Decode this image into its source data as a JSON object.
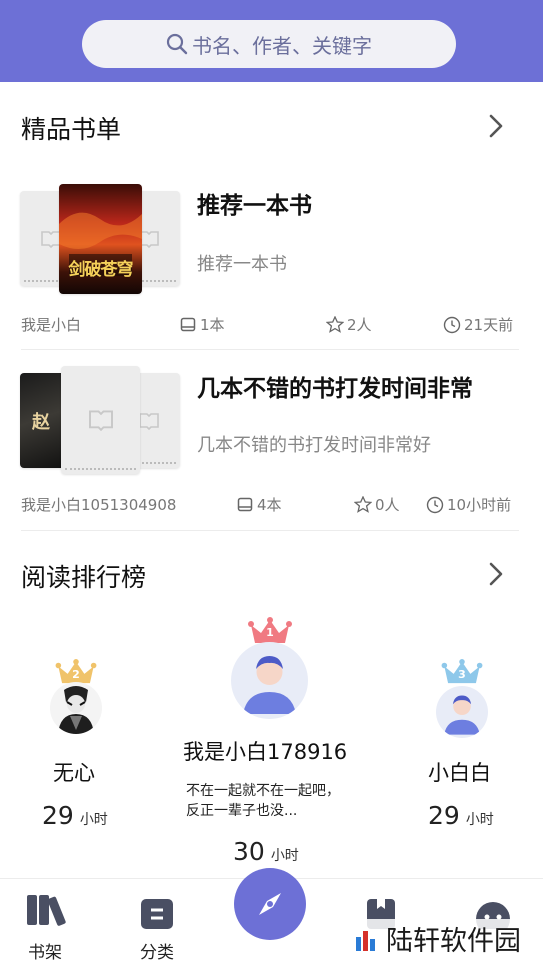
{
  "search": {
    "placeholder": "书名、作者、关键字"
  },
  "booklist_section": {
    "title": "精品书单",
    "cards": [
      {
        "title": "推荐一本书",
        "desc": "推荐一本书",
        "author": "我是小白",
        "count": "1本",
        "likes": "2人",
        "time": "21天前",
        "cover_text": "剑破苍穹"
      },
      {
        "title": "几本不错的书打发时间非常",
        "desc": "几本不错的书打发时间非常好",
        "author": "我是小白1051304908",
        "count": "4本",
        "likes": "0人",
        "time": "10小时前",
        "cover_text": "赵"
      }
    ]
  },
  "ranking_section": {
    "title": "阅读排行榜",
    "first": {
      "rank": "1",
      "name": "我是小白178916",
      "motto": "不在一起就不在一起吧，反正一辈子也没...",
      "hours": "30",
      "unit": "小时",
      "crown_color": "#f07a82"
    },
    "second": {
      "rank": "2",
      "name": "无心",
      "hours": "29",
      "unit": "小时",
      "crown_color": "#f0c36a"
    },
    "third": {
      "rank": "3",
      "name": "小白白",
      "hours": "29",
      "unit": "小时",
      "crown_color": "#8ec8ea"
    }
  },
  "tabbar": {
    "tabs": [
      {
        "label": "书架",
        "icon": "bookshelf-icon"
      },
      {
        "label": "分类",
        "icon": "category-icon"
      },
      {
        "label": "",
        "icon": "compass-icon"
      },
      {
        "label": "",
        "icon": "bookmark-icon"
      },
      {
        "label": "",
        "icon": "profile-icon"
      }
    ]
  },
  "watermark": {
    "text": "陆轩软件园"
  },
  "colors": {
    "accent": "#6d70d6",
    "header": "#6d70d6"
  }
}
